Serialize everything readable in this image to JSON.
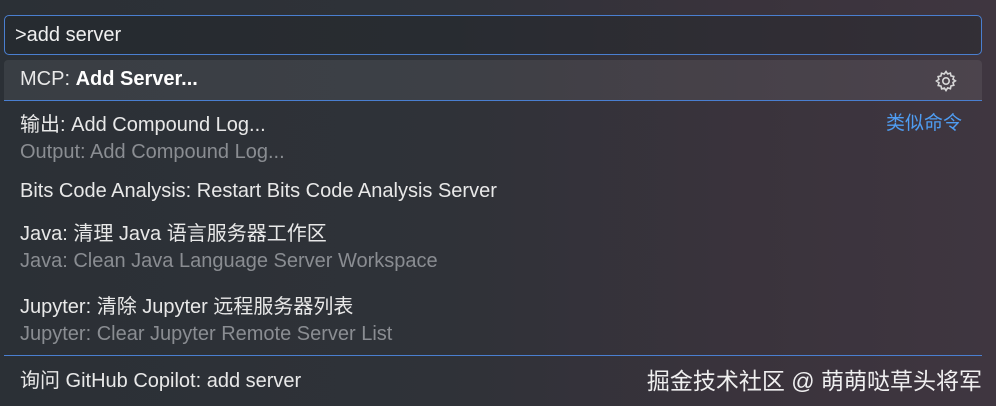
{
  "search": {
    "value": ">add server"
  },
  "items": [
    {
      "prefix": "MCP: ",
      "label": "Add Server...",
      "action_icon": "gear-icon"
    },
    {
      "label": "输出: Add Compound Log...",
      "detail": "Output: Add Compound Log...",
      "badge": "类似命令"
    },
    {
      "label": "Bits Code Analysis: Restart Bits Code Analysis Server"
    },
    {
      "label": "Java: 清理 Java 语言服务器工作区",
      "detail": "Java: Clean Java Language Server Workspace"
    },
    {
      "label": "Jupyter: 清除 Jupyter 远程服务器列表",
      "detail": "Jupyter: Clear Jupyter Remote Server List"
    }
  ],
  "footer": {
    "label": "询问 GitHub Copilot: add server"
  },
  "watermark": "掘金技术社区 @ 萌萌哒草头将军",
  "colors": {
    "accent": "#4a7fd0",
    "link": "#4f9df2",
    "secondary_text": "#8a8d92"
  }
}
